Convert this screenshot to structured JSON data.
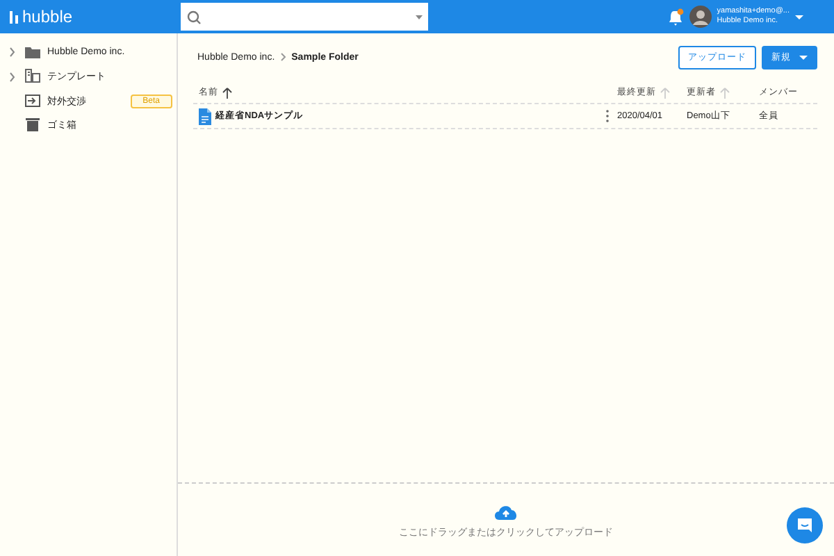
{
  "header": {
    "logo": "hubble",
    "notification": true,
    "account": {
      "email": "yamashita+demo@...",
      "org": "Hubble Demo inc."
    }
  },
  "sidebar": {
    "items": [
      {
        "label": "Hubble Demo inc.",
        "expandable": true
      },
      {
        "label": "テンプレート",
        "expandable": true
      },
      {
        "label": "対外交渉",
        "expandable": false,
        "badge": "Beta"
      },
      {
        "label": "ゴミ箱",
        "expandable": false
      }
    ]
  },
  "breadcrumb": [
    {
      "label": "Hubble Demo inc.",
      "current": false
    },
    {
      "label": "Sample Folder",
      "current": true
    }
  ],
  "buttons": {
    "upload": "アップロード",
    "new": "新規"
  },
  "table": {
    "columns": [
      {
        "label": "名前",
        "sorted": true
      },
      {
        "label": "最終更新",
        "sorted": false
      },
      {
        "label": "更新者",
        "sorted": false
      },
      {
        "label": "メンバー"
      }
    ],
    "rows": [
      {
        "name": "経産省NDAサンプル",
        "updated": "2020/04/01",
        "updater": "Demo山下",
        "members": "全員"
      }
    ]
  },
  "dropzone": {
    "text": "ここにドラッグまたはクリックしてアップロード"
  }
}
